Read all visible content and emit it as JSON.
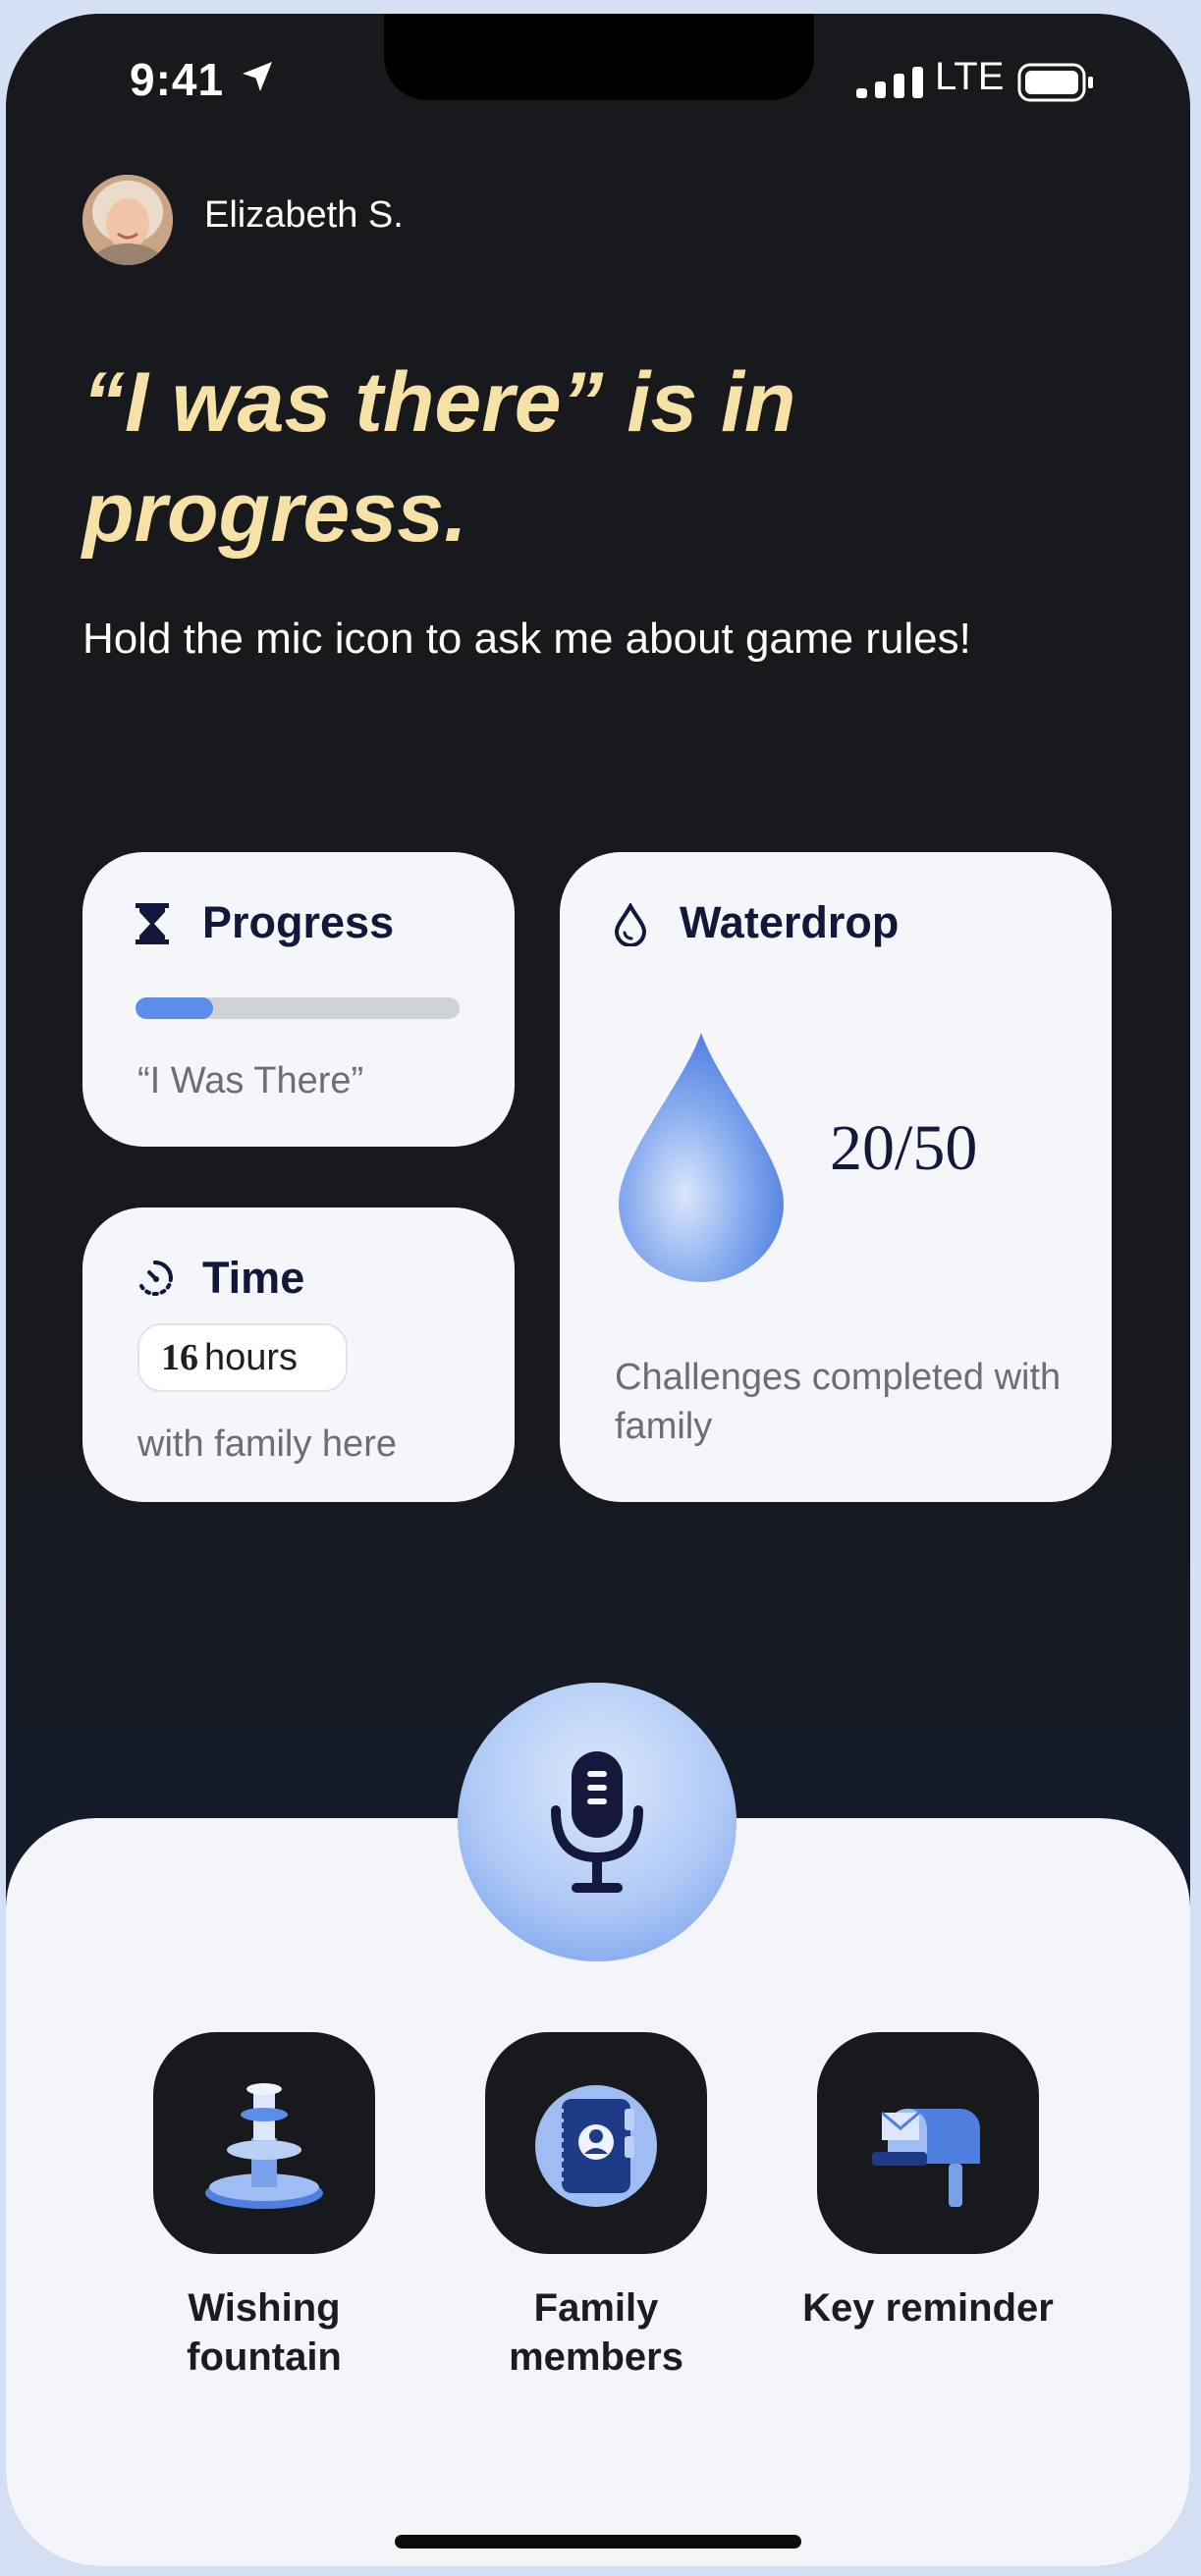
{
  "status_bar": {
    "time": "9:41",
    "network": "LTE"
  },
  "user": {
    "name": "Elizabeth S."
  },
  "headline": "“I was there” is in progress.",
  "subtitle": "Hold the mic icon to ask me about game rules!",
  "progress_card": {
    "title": "Progress",
    "game_name": "“I Was There”",
    "progress_fraction": 0.24
  },
  "time_card": {
    "title": "Time",
    "hours_value": "16",
    "hours_unit": "hours",
    "caption": "with family here"
  },
  "waterdrop_card": {
    "title": "Waterdrop",
    "count": "20/50",
    "caption": "Challenges completed with family"
  },
  "actions": [
    {
      "label": "Wishing fountain",
      "icon": "fountain-icon"
    },
    {
      "label": "Family members",
      "icon": "contact-book-icon"
    },
    {
      "label": "Key reminder",
      "icon": "mailbox-icon"
    }
  ],
  "colors": {
    "accent": "#5a8ee9",
    "headline": "#f6e2a6",
    "background": "#17191c",
    "card": "#f4f6fa"
  }
}
